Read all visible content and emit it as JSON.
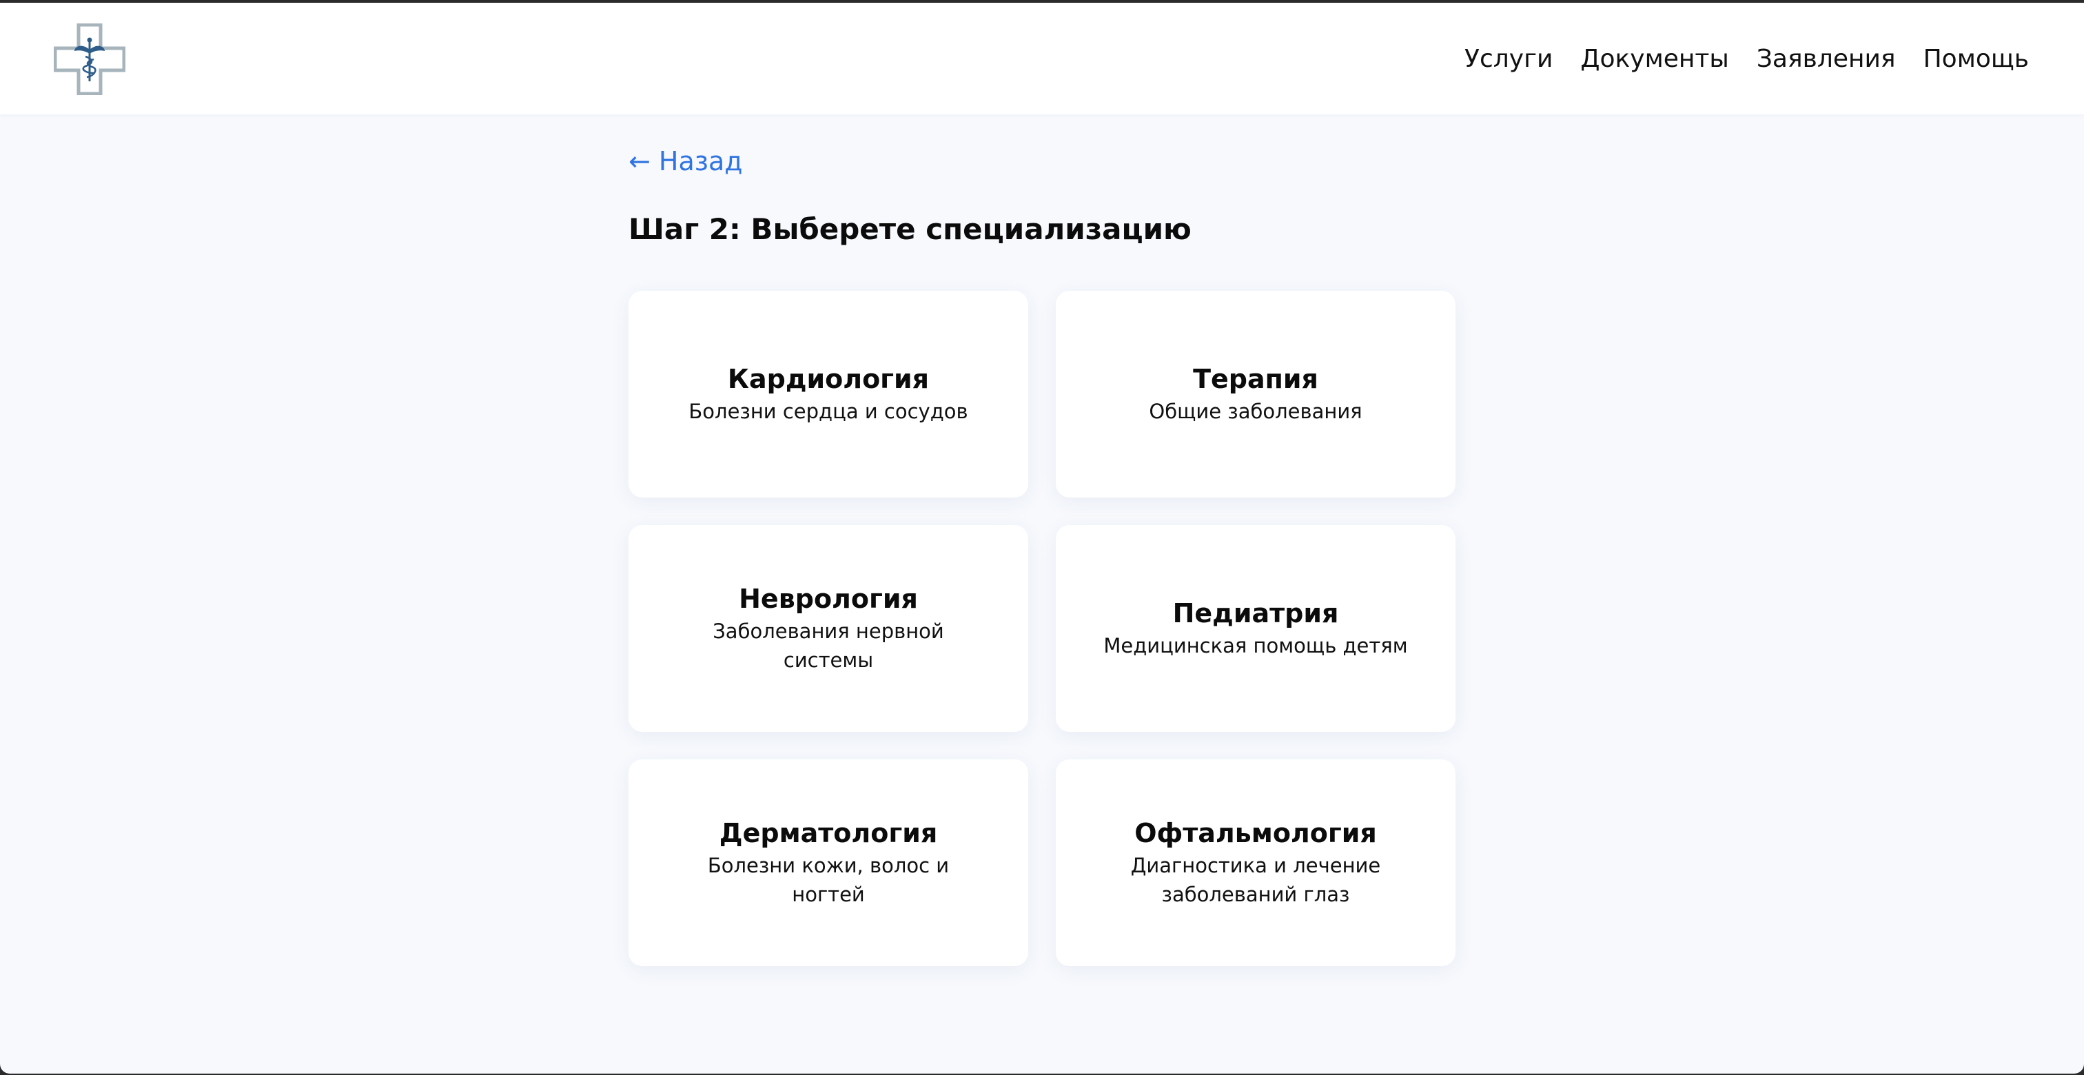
{
  "header": {
    "logo_icon": "medical-cross-caduceus-icon",
    "nav": [
      {
        "label": "Услуги"
      },
      {
        "label": "Документы"
      },
      {
        "label": "Заявления"
      },
      {
        "label": "Помощь"
      }
    ]
  },
  "main": {
    "back_label": "← Назад",
    "step_title": "Шаг 2: Выберете специализацию",
    "cards": [
      {
        "title": "Кардиология",
        "description": "Болезни сердца и сосудов"
      },
      {
        "title": "Терапия",
        "description": "Общие заболевания"
      },
      {
        "title": "Неврология",
        "description": "Заболевания нервной системы"
      },
      {
        "title": "Педиатрия",
        "description": "Медицинская помощь детям"
      },
      {
        "title": "Дерматология",
        "description": "Болезни кожи, волос и ногтей"
      },
      {
        "title": "Офтальмология",
        "description": "Диагностика и лечение заболеваний глаз"
      }
    ]
  },
  "colors": {
    "page_background": "#f7f9fd",
    "link": "#2f74e0",
    "logo_cross": "#a7b4bc",
    "logo_emblem": "#2e5d8a"
  }
}
